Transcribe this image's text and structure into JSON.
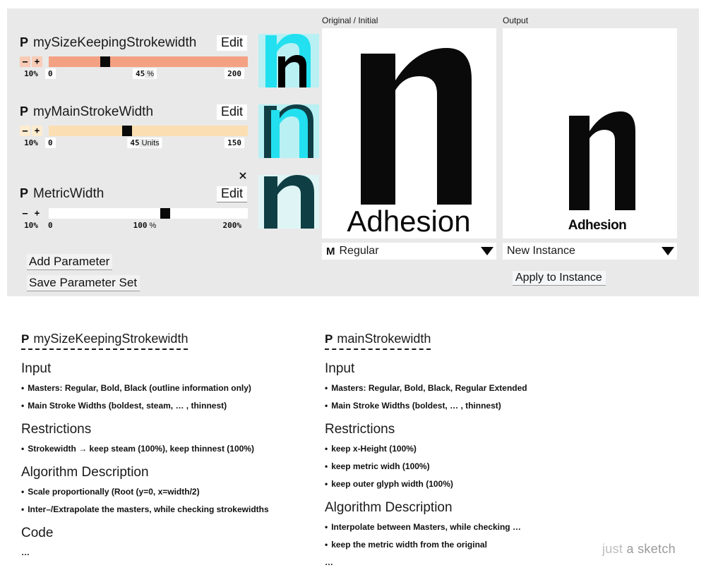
{
  "panel": {
    "parameters": [
      {
        "tag": "P",
        "name": "mySizeKeepingStrokewidth",
        "edit_label": "Edit",
        "step_minus": "–",
        "step_plus": "+",
        "step_pct": "10%",
        "min": "0",
        "value": "45",
        "unit": "%",
        "max": "200",
        "track_color": "#f4a183",
        "thumb_pct": 26
      },
      {
        "tag": "P",
        "name": "myMainStrokeWidth",
        "edit_label": "Edit",
        "step_minus": "–",
        "step_plus": "+",
        "step_pct": "10%",
        "min": "0",
        "value": "45",
        "unit": "Units",
        "max": "150",
        "track_color": "#fbdfb3",
        "thumb_pct": 37
      },
      {
        "tag": "P",
        "name": "MetricWidth",
        "edit_label": "Edit",
        "close_label": "×",
        "step_minus": "–",
        "step_plus": "+",
        "step_pct": "10%",
        "min": "0",
        "value": "100",
        "unit": "%",
        "max": "200%",
        "track_color": "#ffffff",
        "thumb_pct": 56
      }
    ],
    "actions": {
      "add_parameter": "Add Parameter",
      "save_parameter_set": "Save Parameter Set"
    },
    "preview_left": {
      "label": "Original / Initial",
      "glyph": "n",
      "word": "Adhesion",
      "dropdown_tag": "M",
      "dropdown_value": "Regular"
    },
    "preview_right": {
      "label": "Output",
      "glyph": "n",
      "word": "Adhesion",
      "dropdown_value": "New Instance",
      "apply_label": "Apply to Instance"
    },
    "colors": {
      "panel_background": "#e9e9e9",
      "glyph_cyan": "#22e0ef",
      "glyph_cyan_light": "#b9f0f3",
      "glyph_teal": "#114murk",
      "glyph_dark_teal": "#0f3f45",
      "glyph_black": "#000000",
      "slider_salmon": "#f4a183",
      "slider_peach": "#fbdfb3"
    }
  },
  "docs": [
    {
      "tag": "P",
      "title": "mySizeKeepingStrokewidth",
      "sections": [
        {
          "heading": "Input",
          "bullets": [
            "Masters: Regular, Bold, Black (outline information only)",
            "Main Stroke Widths (boldest, steam, … , thinnest)"
          ]
        },
        {
          "heading": "Restrictions",
          "bullets": [
            "Strokewidth → keep steam (100%), keep thinnest (100%)"
          ]
        },
        {
          "heading": "Algorithm Description",
          "bullets": [
            "Scale proportionally (Root (y=0, x=width/2)",
            "Inter–/Extrapolate the masters, while checking strokewidths"
          ]
        },
        {
          "heading": "Code",
          "bullets": [],
          "ellipsis": "…"
        }
      ]
    },
    {
      "tag": "P",
      "title": "mainStrokewidth",
      "sections": [
        {
          "heading": "Input",
          "bullets": [
            "Masters: Regular, Bold, Black, Regular Extended",
            "Main Stroke Widths (boldest, … , thinnest)"
          ]
        },
        {
          "heading": "Restrictions",
          "bullets": [
            "keep x-Height (100%)",
            "keep metric widh (100%)",
            "keep outer glyph width (100%)"
          ]
        },
        {
          "heading": "Algorithm Description",
          "bullets": [
            "Interpolate between Masters, while checking …",
            "keep the metric width from the original"
          ],
          "ellipsis": "…"
        }
      ]
    }
  ],
  "watermark": {
    "light": "just ",
    "bold": "a sketch"
  }
}
